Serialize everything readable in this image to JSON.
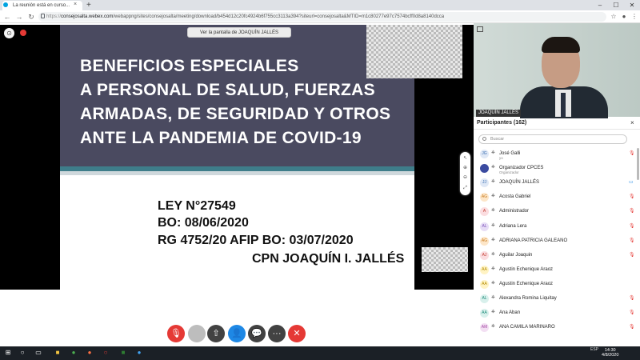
{
  "browser": {
    "tab_title": "La reunión está en curso...",
    "tab_close": "×",
    "new_tab": "+",
    "url_host": "consejosalta.webex.com",
    "url_path": "/webappng/sites/consejosalta/meeting/download/b454d12c20fc4924b6f755cc3113a394?siteurl=consejosalta&MTID=m1c80277e97c7574bcff0d8a8140dcca",
    "url_prefix": "https://",
    "win_minimize": "–",
    "win_maximize": "☐",
    "win_close": "✕"
  },
  "meeting": {
    "viewing_label": "Ver la pantalla de JOAQUÍN JALLÉS",
    "slide": {
      "title_lines": [
        "BENEFICIOS ESPECIALES",
        "A PERSONAL DE SALUD, FUERZAS",
        "ARMADAS, DE SEGURIDAD Y OTROS",
        "ANTE LA PANDEMIA DE COVID-19"
      ],
      "law": "LEY N°27549",
      "bo": "BO: 08/06/2020",
      "rg": "RG 4752/20 AFIP BO: 03/07/2020",
      "author": "CPN JOAQUÍN I. JALLÉS"
    },
    "controls": {
      "mic": "🎙",
      "video": "",
      "share": "⇧",
      "participants": "👤",
      "chat": "💬",
      "more": "···",
      "leave": "✕"
    },
    "colors": {
      "mic": "#e53935",
      "video": "#bdbdbd",
      "share": "#424242",
      "participants": "#1e88e5",
      "chat": "#424242",
      "more": "#424242",
      "leave": "#e53935"
    }
  },
  "video": {
    "speaker_name": "JOAQUÍN JALLÉS"
  },
  "participants": {
    "title": "Participantes (162)",
    "close": "×",
    "search_placeholder": "Buscar",
    "list": [
      {
        "initials": "JG",
        "name": "José Galli",
        "sub": "yo",
        "av_color": "#dfe8f6",
        "av_text": "#3a6fb0",
        "mic": "🎙"
      },
      {
        "initials": "",
        "name": "Organizador CPCES",
        "sub": "Organizador",
        "av_color": "#3b4ba0",
        "av_text": "#fff",
        "mic": ""
      },
      {
        "initials": "JJ",
        "name": "JOAQUÍN JALLÉS",
        "sub": "",
        "av_color": "#dfe8f6",
        "av_text": "#3a6fb0",
        "mic": "▭"
      },
      {
        "initials": "AG",
        "name": "Acosta Gabriel",
        "sub": "",
        "av_color": "#fde6c8",
        "av_text": "#c77a1e",
        "mic": "🎙"
      },
      {
        "initials": "A",
        "name": "Administrador",
        "sub": "",
        "av_color": "#fbdde0",
        "av_text": "#c0392b",
        "mic": "🎙"
      },
      {
        "initials": "AL",
        "name": "Adriana Lera",
        "sub": "",
        "av_color": "#e7ddf6",
        "av_text": "#7b52b9",
        "mic": "🎙"
      },
      {
        "initials": "AG",
        "name": "ADRIANA PATRICIA GALEANO",
        "sub": "",
        "av_color": "#fde6c8",
        "av_text": "#c77a1e",
        "mic": "🎙"
      },
      {
        "initials": "AJ",
        "name": "Aguilar Joaquin",
        "sub": "",
        "av_color": "#fbdde0",
        "av_text": "#c0392b",
        "mic": "🎙"
      },
      {
        "initials": "AA",
        "name": "Agustin Echenique Araoz",
        "sub": "",
        "av_color": "#fff3c4",
        "av_text": "#b38b00",
        "mic": ""
      },
      {
        "initials": "AA",
        "name": "Agustin Echenique Araoz",
        "sub": "",
        "av_color": "#fff3c4",
        "av_text": "#b38b00",
        "mic": ""
      },
      {
        "initials": "AL",
        "name": "Alexandra Romina Liquitay",
        "sub": "",
        "av_color": "#d8f0ec",
        "av_text": "#1f8c7a",
        "mic": "🎙"
      },
      {
        "initials": "AA",
        "name": "Ana Aban",
        "sub": "",
        "av_color": "#d8f0ec",
        "av_text": "#1f8c7a",
        "mic": "🎙"
      },
      {
        "initials": "AM",
        "name": "ANA CAMILA MARINARO",
        "sub": "",
        "av_color": "#f3dff3",
        "av_text": "#a44ca4",
        "mic": "🎙"
      }
    ]
  },
  "taskbar": {
    "lang": "ESP",
    "time": "14:30",
    "date": "4/8/2020"
  }
}
